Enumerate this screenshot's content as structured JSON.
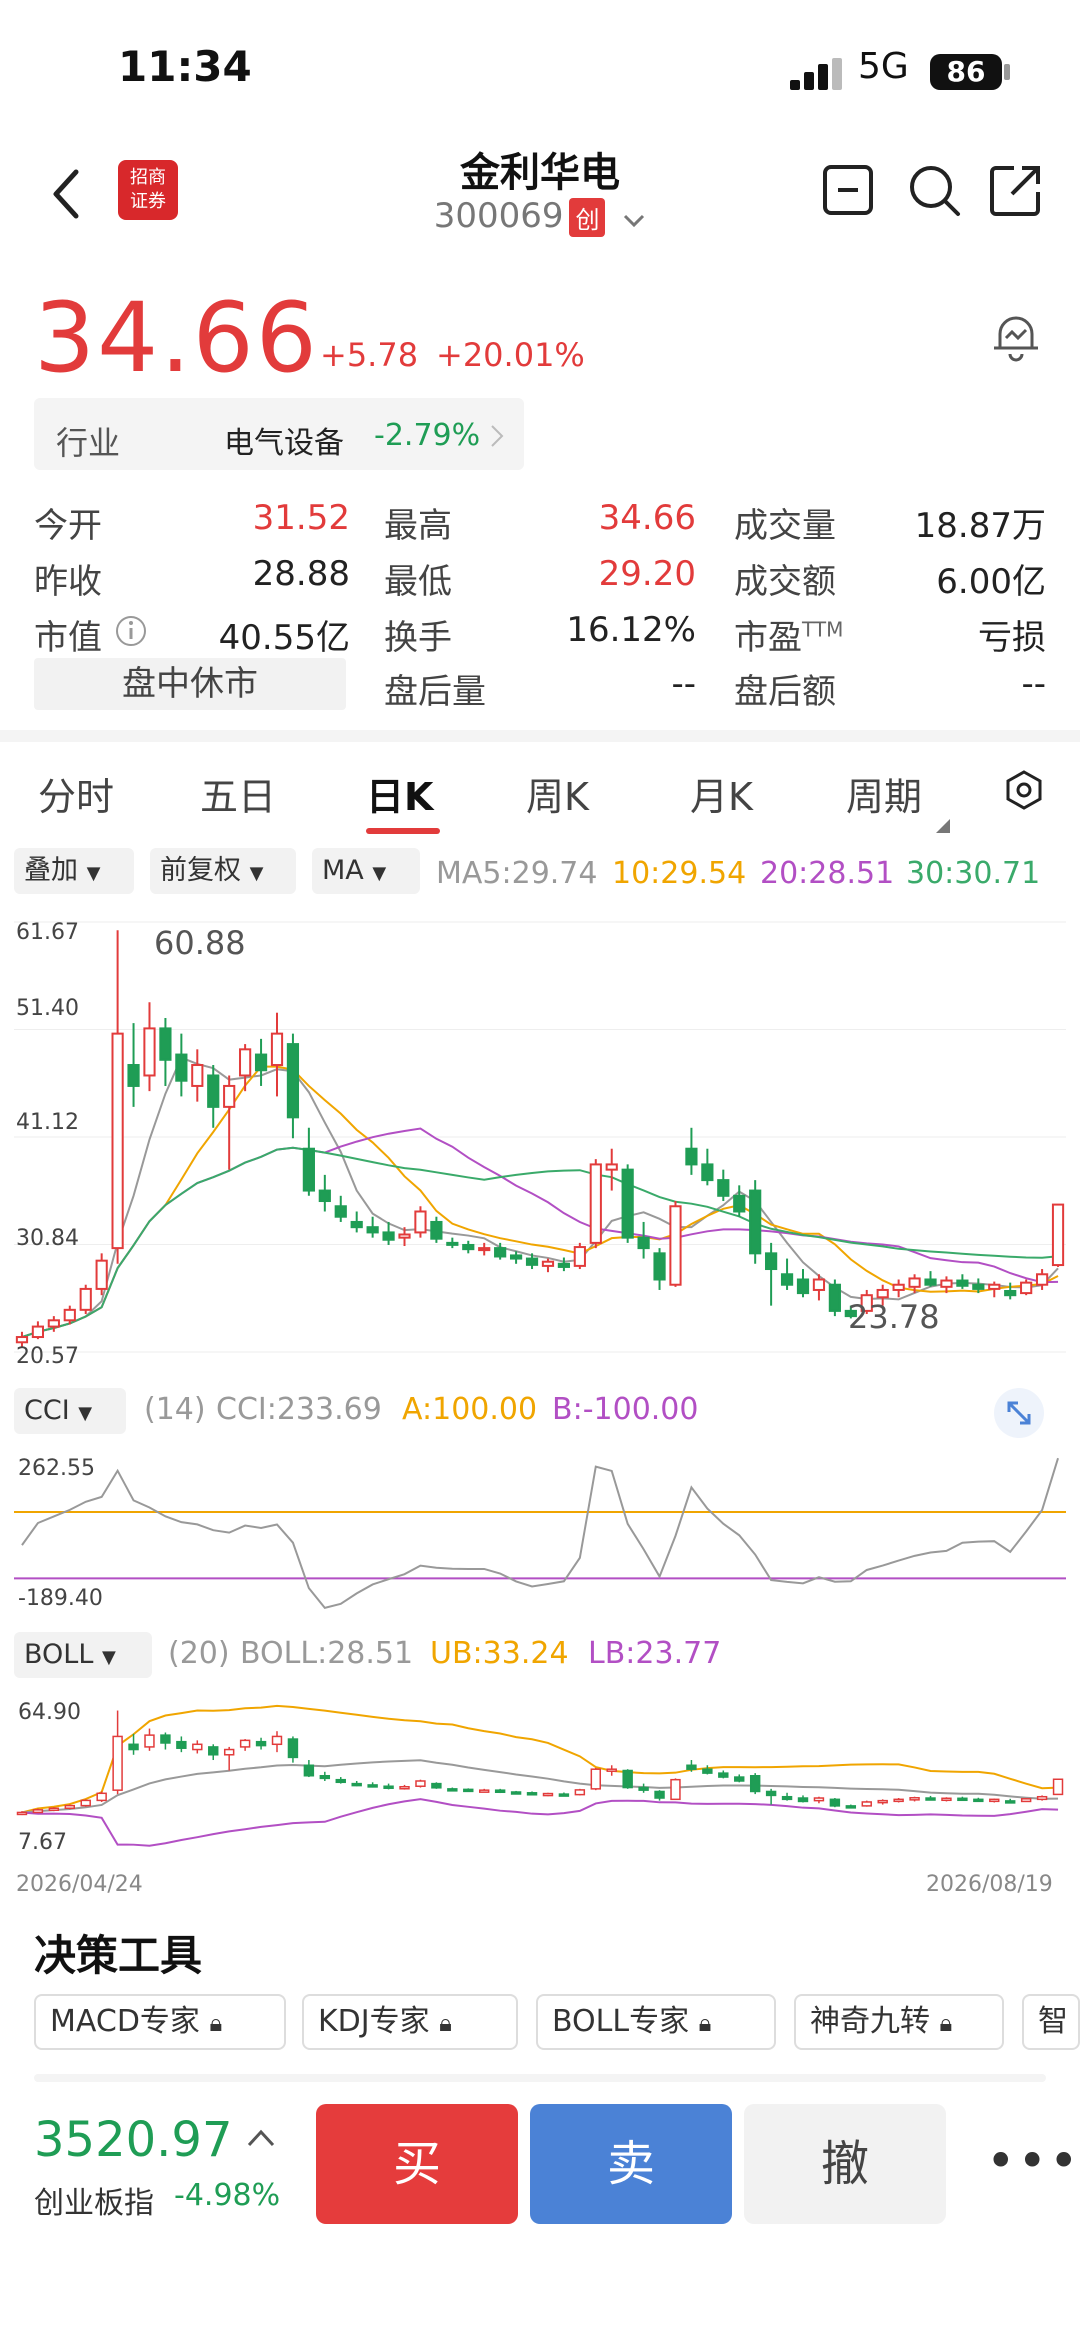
{
  "status": {
    "time": "11:34",
    "network": "5G",
    "battery": "86"
  },
  "header": {
    "name": "金利华电",
    "code": "300069",
    "board_badge": "创",
    "broker_logo_text": "招商证券"
  },
  "quote": {
    "price": "34.66",
    "change": "+5.78",
    "change_pct": "+20.01%"
  },
  "industry": {
    "label": "行业",
    "name": "电气设备",
    "pct": "-2.79%"
  },
  "stats": {
    "open_label": "今开",
    "open": "31.52",
    "high_label": "最高",
    "high": "34.66",
    "volume_label": "成交量",
    "volume": "18.87万",
    "prev_label": "昨收",
    "prev": "28.88",
    "low_label": "最低",
    "low": "29.20",
    "amount_label": "成交额",
    "amount": "6.00亿",
    "mcap_label": "市值",
    "mcap": "40.55亿",
    "turnover_label": "换手",
    "turnover": "16.12%",
    "pe_label": "市盈",
    "pe_sup": "TTM",
    "pe": "亏损",
    "session": "盘中休市",
    "after_vol_label": "盘后量",
    "after_vol": "--",
    "after_amt_label": "盘后额",
    "after_amt": "--"
  },
  "tabs": [
    "分时",
    "五日",
    "日K",
    "周K",
    "月K",
    "周期"
  ],
  "chart_controls": {
    "overlay": "叠加",
    "adjust": "前复权",
    "indicator": "MA"
  },
  "ma_values": {
    "ma5": "MA5:29.74",
    "ma10": "10:29.54",
    "ma20": "20:28.51",
    "ma30": "30:30.71"
  },
  "colors": {
    "up": "#e23b3b",
    "down": "#1f9d55",
    "ma5": "#999999",
    "ma10": "#f0a500",
    "ma20": "#b24fc4",
    "ma30": "#3aaa6a"
  },
  "kline": {
    "yticks": [
      "61.67",
      "51.40",
      "41.12",
      "30.84",
      "20.57"
    ],
    "max_label": "60.88",
    "min_label": "23.78"
  },
  "cci": {
    "name": "CCI",
    "param": "(14)",
    "value": "CCI:233.69",
    "a": "A:100.00",
    "b": "B:-100.00",
    "ytop": "262.55",
    "ybottom": "-189.40"
  },
  "boll": {
    "name": "BOLL",
    "param": "(20)",
    "value": "BOLL:28.51",
    "ub": "UB:33.24",
    "lb": "LB:23.77",
    "ytop": "64.90",
    "ybottom": "7.67"
  },
  "dates": {
    "start": "2026/04/24",
    "end": "2026/08/19"
  },
  "chart_data": {
    "type": "candlestick",
    "ylim": [
      20.57,
      61.67
    ],
    "candles": [
      [
        21.5,
        22.5,
        21.0,
        22.0
      ],
      [
        22.0,
        23.5,
        21.8,
        23.0
      ],
      [
        23.0,
        24.0,
        22.5,
        23.6
      ],
      [
        23.6,
        25.0,
        23.2,
        24.6
      ],
      [
        24.6,
        27.0,
        24.2,
        26.6
      ],
      [
        26.6,
        30.0,
        26.0,
        29.3
      ],
      [
        30.5,
        60.88,
        29.0,
        51.0
      ],
      [
        48.0,
        52.0,
        44.0,
        46.0
      ],
      [
        47.0,
        54.0,
        45.5,
        51.5
      ],
      [
        51.5,
        52.5,
        46.0,
        48.5
      ],
      [
        49.0,
        51.0,
        45.0,
        46.5
      ],
      [
        46.0,
        49.5,
        44.5,
        48.0
      ],
      [
        47.0,
        48.0,
        42.0,
        44.0
      ],
      [
        44.0,
        47.0,
        38.0,
        46.0
      ],
      [
        47.0,
        50.0,
        45.5,
        49.5
      ],
      [
        49.0,
        50.5,
        46.0,
        47.5
      ],
      [
        48.0,
        53.0,
        45.0,
        51.0
      ],
      [
        50.0,
        51.0,
        41.0,
        43.0
      ],
      [
        40.0,
        42.0,
        35.5,
        36.0
      ],
      [
        36.0,
        37.5,
        34.0,
        35.0
      ],
      [
        34.5,
        35.5,
        33.0,
        33.5
      ],
      [
        33.0,
        34.0,
        32.0,
        32.5
      ],
      [
        32.5,
        33.5,
        31.5,
        32.0
      ],
      [
        32.0,
        33.0,
        30.8,
        31.3
      ],
      [
        31.5,
        32.5,
        30.7,
        31.8
      ],
      [
        32.0,
        34.5,
        31.5,
        34.0
      ],
      [
        33.0,
        33.5,
        31.0,
        31.4
      ],
      [
        31.0,
        31.5,
        30.5,
        30.9
      ],
      [
        30.8,
        31.2,
        30.0,
        30.4
      ],
      [
        30.4,
        31.0,
        29.8,
        30.5
      ],
      [
        30.5,
        31.0,
        29.4,
        29.7
      ],
      [
        29.8,
        30.2,
        29.0,
        29.5
      ],
      [
        29.5,
        30.0,
        28.5,
        28.9
      ],
      [
        28.8,
        29.5,
        28.2,
        29.2
      ],
      [
        29.0,
        29.6,
        28.3,
        28.7
      ],
      [
        28.8,
        31.0,
        28.5,
        30.6
      ],
      [
        31.0,
        39.0,
        30.5,
        38.5
      ],
      [
        38.0,
        40.0,
        36.0,
        38.5
      ],
      [
        38.0,
        38.5,
        31.0,
        31.5
      ],
      [
        31.5,
        33.0,
        29.5,
        30.5
      ],
      [
        30.0,
        30.5,
        26.5,
        27.5
      ],
      [
        27.0,
        35.0,
        26.8,
        34.5
      ],
      [
        40.0,
        42.0,
        37.5,
        38.5
      ],
      [
        38.5,
        40.0,
        36.5,
        37.0
      ],
      [
        37.0,
        38.0,
        35.0,
        35.5
      ],
      [
        35.5,
        36.5,
        33.5,
        34.0
      ],
      [
        36.0,
        37.0,
        29.0,
        30.0
      ],
      [
        30.0,
        31.0,
        25.0,
        28.5
      ],
      [
        28.0,
        29.5,
        26.5,
        27.0
      ],
      [
        27.5,
        28.5,
        25.8,
        26.2
      ],
      [
        26.5,
        28.0,
        25.5,
        27.5
      ],
      [
        27.0,
        27.5,
        24.0,
        24.5
      ],
      [
        24.5,
        25.0,
        23.78,
        24.0
      ],
      [
        24.5,
        26.5,
        24.2,
        26.0
      ],
      [
        25.8,
        27.0,
        25.0,
        26.5
      ],
      [
        26.5,
        27.5,
        25.8,
        27.0
      ],
      [
        26.8,
        28.0,
        26.2,
        27.6
      ],
      [
        27.5,
        28.3,
        26.8,
        27.0
      ],
      [
        26.8,
        27.8,
        26.2,
        27.4
      ],
      [
        27.4,
        28.0,
        26.6,
        26.9
      ],
      [
        27.0,
        27.6,
        26.2,
        26.6
      ],
      [
        26.6,
        27.3,
        25.8,
        27.0
      ],
      [
        26.4,
        27.2,
        25.6,
        26.0
      ],
      [
        26.2,
        27.5,
        26.0,
        27.2
      ],
      [
        27.0,
        28.5,
        26.5,
        28.0
      ],
      [
        28.88,
        34.66,
        28.7,
        34.66
      ]
    ]
  }
}
